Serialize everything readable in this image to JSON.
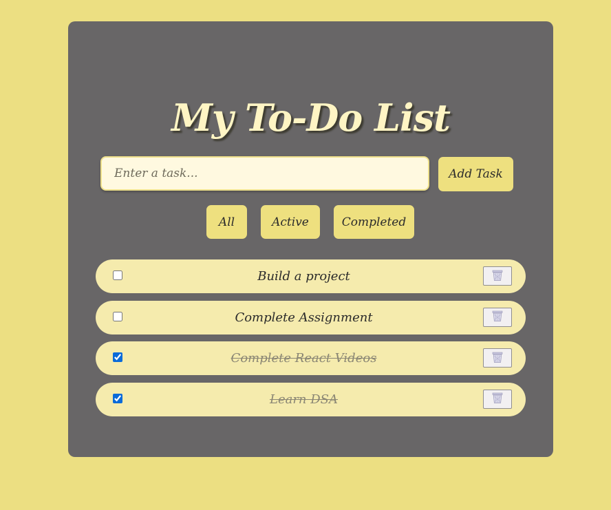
{
  "app": {
    "title": "My To-Do List"
  },
  "input": {
    "placeholder": "Enter a task...",
    "value": "",
    "add_label": "Add Task"
  },
  "filters": [
    {
      "label": "All"
    },
    {
      "label": "Active"
    },
    {
      "label": "Completed"
    }
  ],
  "tasks": [
    {
      "text": "Build a project",
      "completed": false,
      "delete_icon": "trash-bin-icon"
    },
    {
      "text": "Complete Assignment",
      "completed": false,
      "delete_icon": "trash-bin-icon"
    },
    {
      "text": "Complete React Videos",
      "completed": true,
      "delete_icon": "trash-bin-icon"
    },
    {
      "text": "Learn DSA",
      "completed": true,
      "delete_icon": "trash-bin-icon"
    }
  ],
  "colors": {
    "page_background": "#ECDF82",
    "card_background": "#686667",
    "title_color": "#FFF5C4",
    "button_background": "#EEE07F",
    "task_background": "#F5EBAD",
    "completed_text": "#8a8674"
  }
}
